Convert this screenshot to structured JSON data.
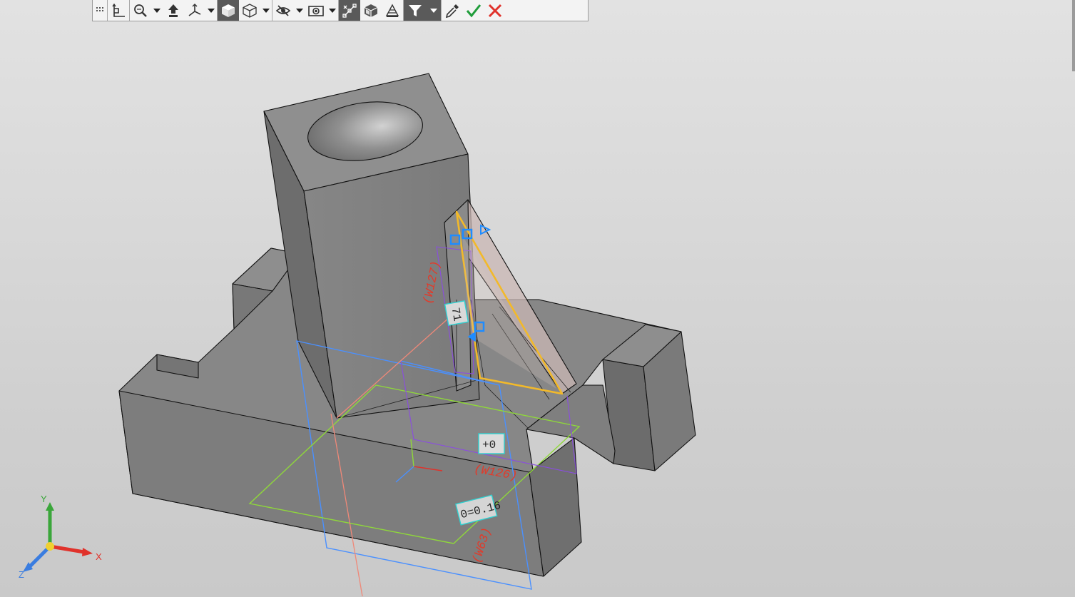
{
  "toolbar": {
    "buttons": [
      {
        "icon": "grip-icon"
      },
      {
        "icon": "orient-tool-icon"
      },
      {
        "icon": "zoom-icon",
        "dropdown": true
      },
      {
        "icon": "pan-icon"
      },
      {
        "icon": "rotate-axes-icon",
        "dropdown": true
      },
      {
        "icon": "shaded-view-icon",
        "active": true
      },
      {
        "icon": "wireframe-view-icon",
        "dropdown": true
      },
      {
        "icon": "hide-icon",
        "dropdown": true
      },
      {
        "icon": "visibility-icon",
        "dropdown": true
      },
      {
        "icon": "snap-points-icon",
        "active": true
      },
      {
        "icon": "shaded-edges-icon"
      },
      {
        "icon": "section-icon"
      },
      {
        "icon": "filter-icon",
        "active": true,
        "dropdown": true
      },
      {
        "icon": "eyedropper-icon"
      },
      {
        "icon": "ok-check-icon"
      },
      {
        "icon": "cancel-x-icon"
      }
    ]
  },
  "viewport": {
    "dimensions": {
      "d1": "(W127)",
      "d2": "(W126)",
      "d3": "(W63)"
    },
    "tags": {
      "t1": "71",
      "t2": "+0",
      "t3": "0=0.16"
    },
    "axes": {
      "x": "X",
      "y": "Y",
      "z": "Z"
    },
    "colors": {
      "body_top": "#8d8d8d",
      "body_side": "#6b6b6b",
      "body_front": "#7b7b7b",
      "highlight": "#f2b92a",
      "plane_blue": "#4a90ff",
      "plane_green": "#8fd83a",
      "plane_purple": "#8a4de0",
      "dim_red": "#e23a2a",
      "handle_blue": "#1e8cff"
    }
  }
}
